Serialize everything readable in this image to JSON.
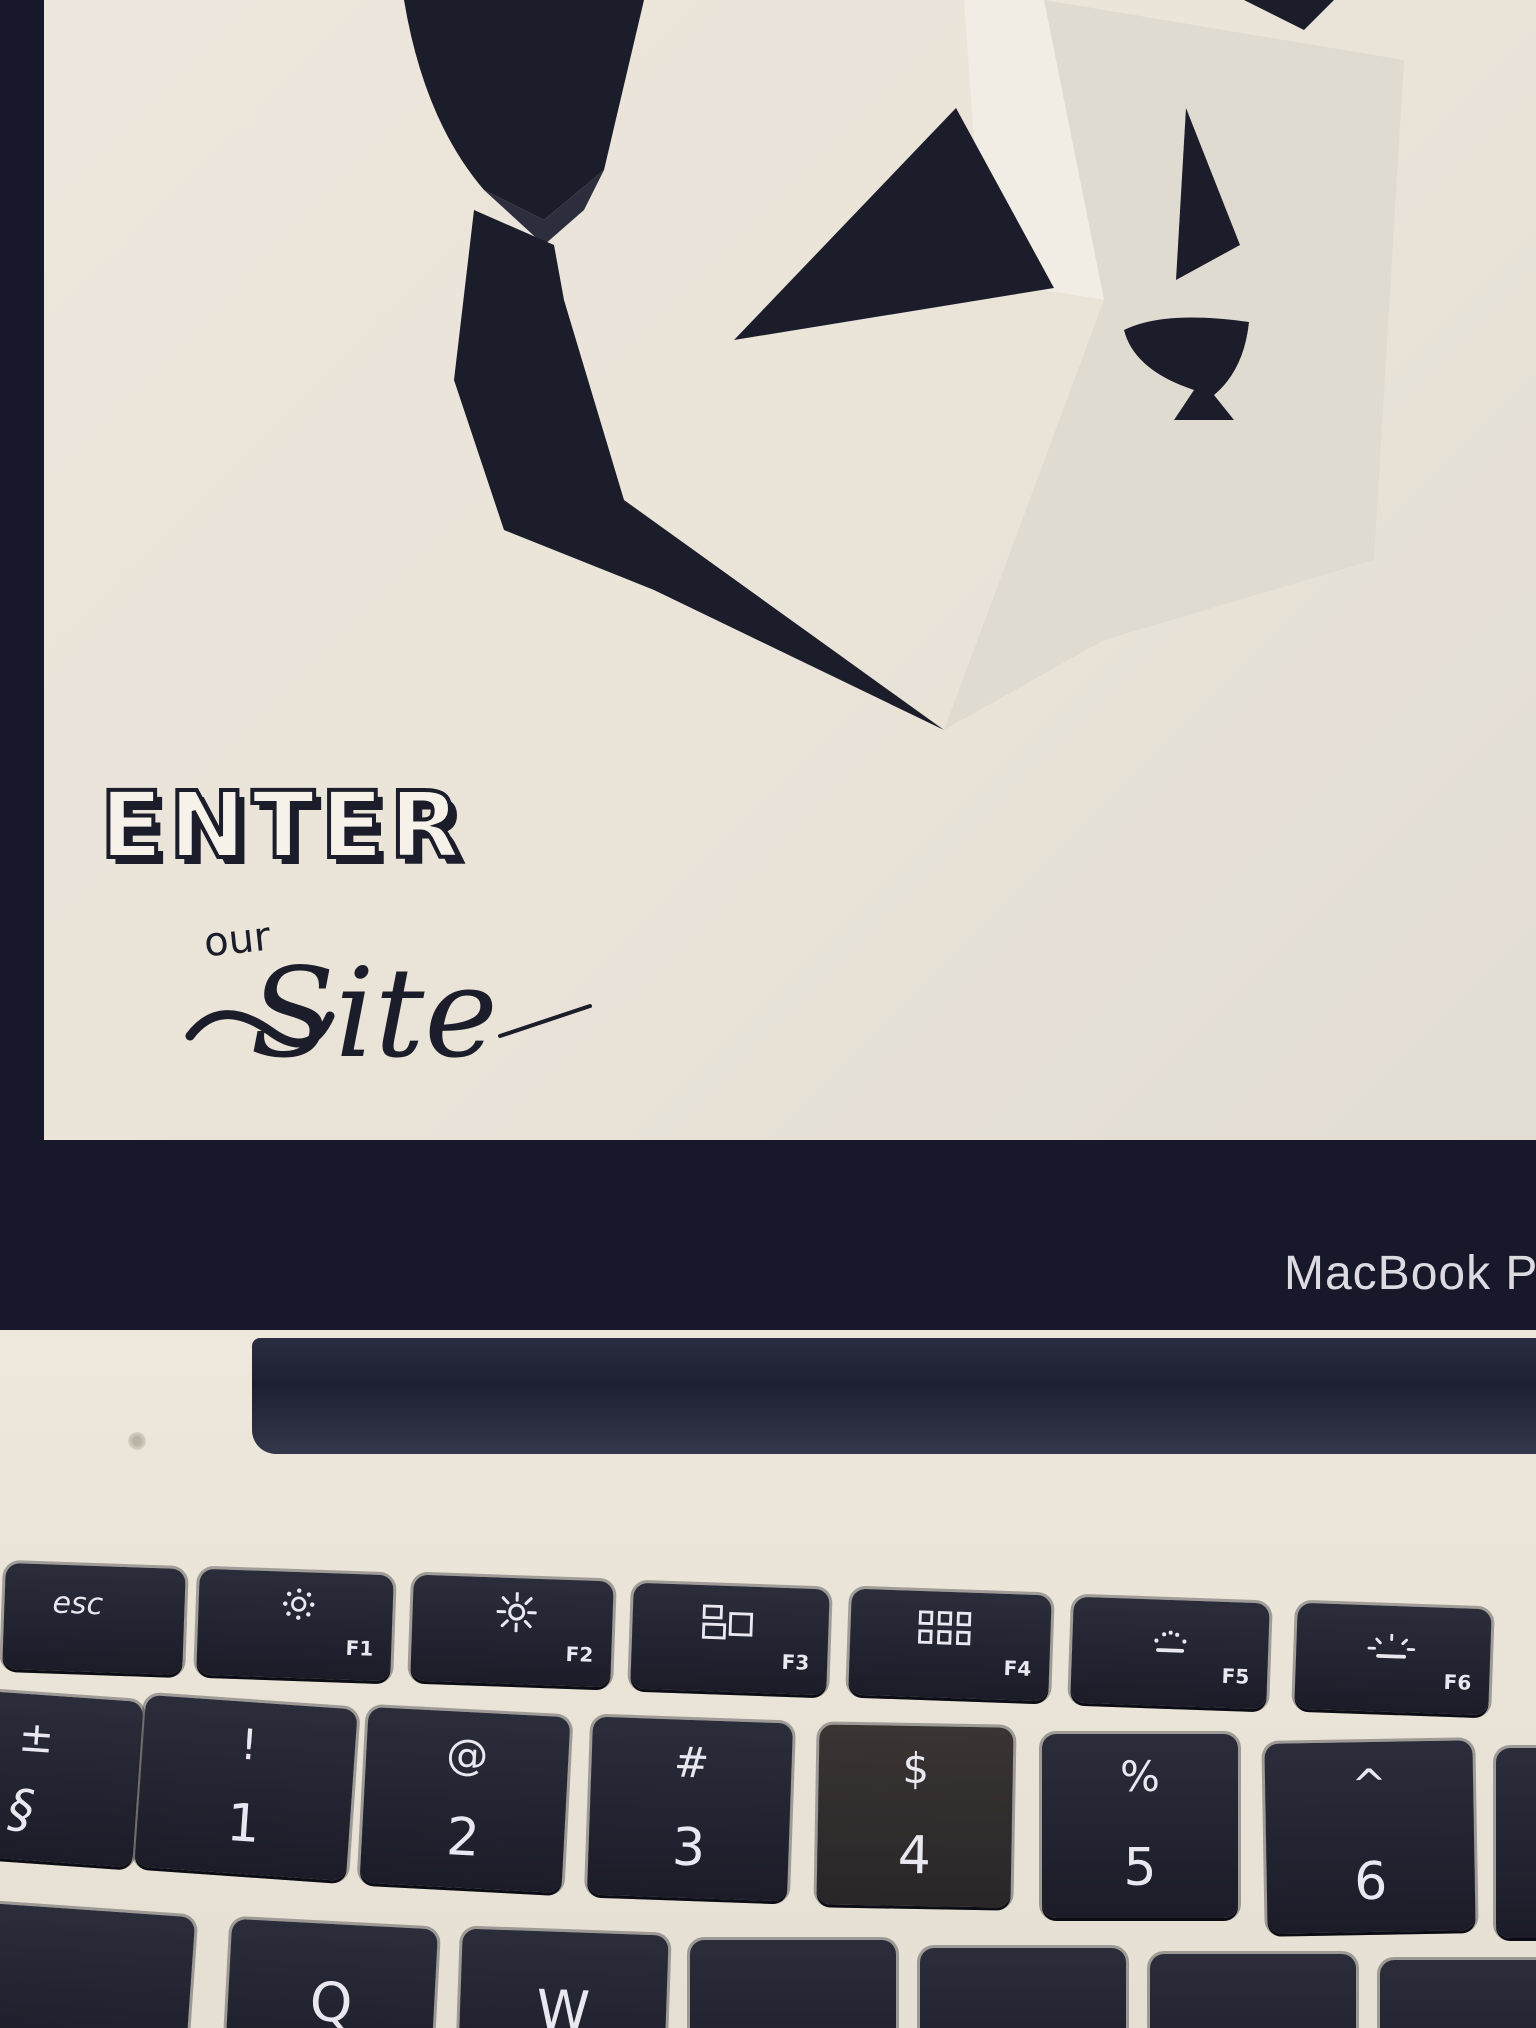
{
  "screen": {
    "cta": {
      "line1": "ENTER",
      "line2": "our",
      "line3": "Site"
    },
    "art": "geometric-panda-head"
  },
  "laptop": {
    "brand_label": "MacBook P"
  },
  "keyboard": {
    "function_row": [
      {
        "label": "esc"
      },
      {
        "fn": "F1",
        "icon": "brightness-down-icon"
      },
      {
        "fn": "F2",
        "icon": "brightness-up-icon"
      },
      {
        "fn": "F3",
        "icon": "mission-control-icon"
      },
      {
        "fn": "F4",
        "icon": "launchpad-icon"
      },
      {
        "fn": "F5",
        "icon": "keyboard-light-down-icon"
      },
      {
        "fn": "F6",
        "icon": "keyboard-light-up-icon"
      }
    ],
    "number_row": [
      {
        "top": "±",
        "bottom": "§"
      },
      {
        "top": "!",
        "bottom": "1"
      },
      {
        "top": "@",
        "bottom": "2"
      },
      {
        "top": "#",
        "bottom": "3"
      },
      {
        "top": "$",
        "bottom": "4"
      },
      {
        "top": "%",
        "bottom": "5"
      },
      {
        "top": "^",
        "bottom": "6"
      }
    ],
    "letter_row": [
      {
        "label": "Q"
      },
      {
        "label": "W"
      }
    ]
  },
  "colors": {
    "ink": "#1c1d2b",
    "screen_bg": "#ece6dc",
    "bezel": "#17192a",
    "key": "#1f2130",
    "key_text": "#e9e7ef"
  }
}
